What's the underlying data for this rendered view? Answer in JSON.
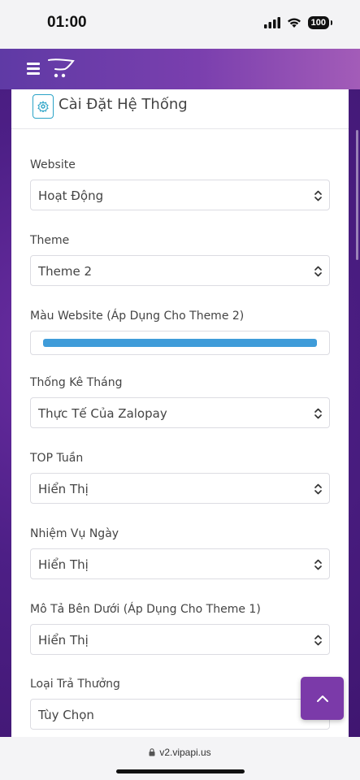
{
  "status_bar": {
    "time": "01:00",
    "battery": "100"
  },
  "app": {
    "colors": {
      "header_start": "#5f3aa5",
      "header_end": "#a35cb8",
      "accent_bar": "#3f9cd9",
      "back_top": "#7b3aa9"
    }
  },
  "card": {
    "title": "Cài Đặt Hệ Thống"
  },
  "fields": {
    "website": {
      "label": "Website",
      "value": "Hoạt Động"
    },
    "theme": {
      "label": "Theme",
      "value": "Theme 2"
    },
    "color": {
      "label": "Màu Website (Áp Dụng Cho Theme 2)",
      "value": "#3f9cd9"
    },
    "stats": {
      "label": "Thống Kê Tháng",
      "value": "Thực Tế Của Zalopay"
    },
    "top_week": {
      "label": "TOP Tuần",
      "value": "Hiển Thị"
    },
    "daily_task": {
      "label": "Nhiệm Vụ Ngày",
      "value": "Hiển Thị"
    },
    "description": {
      "label": "Mô Tả Bên Dưới (Áp Dụng Cho Theme 1)",
      "value": "Hiển Thị"
    },
    "reward_type": {
      "label": "Loại Trả Thưởng",
      "value": "Tùy Chọn"
    }
  },
  "browser": {
    "url": "v2.vipapi.us"
  }
}
